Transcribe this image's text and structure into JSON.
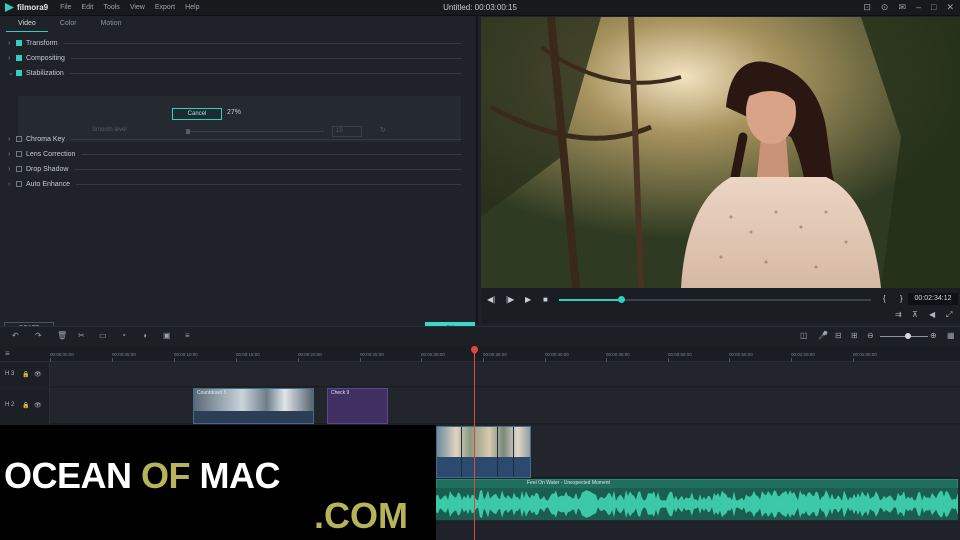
{
  "menubar": {
    "app_name": "filmora9",
    "menu": [
      "File",
      "Edit",
      "Tools",
      "View",
      "Export",
      "Help"
    ],
    "title": "Untitled:  00:03:00:15"
  },
  "panel": {
    "tabs": [
      "Video",
      "Color",
      "Motion"
    ],
    "properties": [
      {
        "label": "Transform",
        "checked": true,
        "expanded": false
      },
      {
        "label": "Compositing",
        "checked": true,
        "expanded": false
      },
      {
        "label": "Stabilization",
        "checked": true,
        "expanded": true
      },
      {
        "label": "Chroma Key",
        "checked": false,
        "expanded": false
      },
      {
        "label": "Lens Correction",
        "checked": false,
        "expanded": false
      },
      {
        "label": "Drop Shadow",
        "checked": false,
        "expanded": false
      },
      {
        "label": "Auto Enhance",
        "checked": false,
        "expanded": false
      }
    ],
    "stabilization": {
      "cancel_label": "Cancel",
      "progress": "27%",
      "smooth_label": "Smooth level",
      "smooth_value": "10"
    },
    "reset_label": "RESET",
    "ok_label": "OK"
  },
  "player": {
    "progress": 0.2,
    "timecode": "00:02:34:12"
  },
  "ruler": {
    "labels": [
      "00:00:00:00",
      "00:00:05:00",
      "00:00:10:00",
      "00:00:15:00",
      "00:00:20:00",
      "00:00:25:00",
      "00:00:30:00",
      "00:00:35:00",
      "00:00:40:00",
      "00:00:45:00",
      "00:00:50:00",
      "00:00:55:00",
      "00:01:00:00",
      "00:01:05:00"
    ]
  },
  "tracks": {
    "track3": "3",
    "track2": "2",
    "clips": {
      "countdown": "Countdown 5",
      "check": "Check 9",
      "audio": "Feel On Water - Unexpected Moment",
      "audio_left": "Feel On Water - Unexpected Moment"
    }
  },
  "watermark": {
    "ocean": "OCEAN",
    "of": "OF",
    "mac": "MAC",
    "com": ".COM"
  },
  "colors": {
    "accent": "#2fd0c0",
    "playhead": "#e2483b",
    "watermark_gold": "#b7b35a"
  }
}
